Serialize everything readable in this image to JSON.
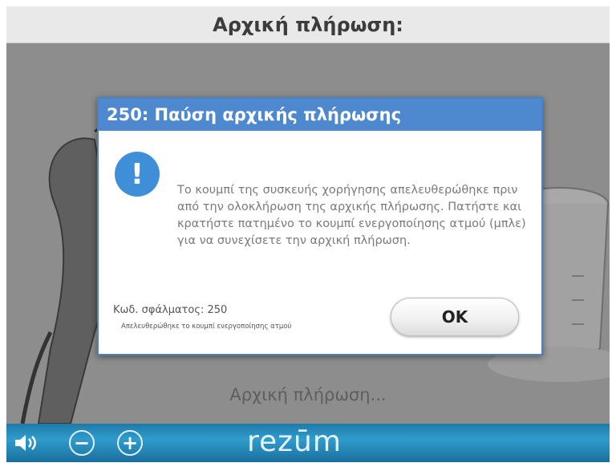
{
  "header": {
    "title": "Αρχική πλήρωση:"
  },
  "background": {
    "status_text": "Αρχική πλήρωση..."
  },
  "footer": {
    "brand": "rezūm",
    "speaker_icon": "speaker-icon",
    "minus_label": "−",
    "plus_label": "+"
  },
  "dialog": {
    "title": "250: Παύση αρχικής πλήρωσης",
    "icon_glyph": "!",
    "message": "Το κουμπί της συσκευής χορήγησης απελευθερώθηκε πριν από την ολοκλήρωση της αρχικής πλήρωσης. Πατήστε και κρατήστε πατημένο το κουμπί ενεργοποίησης ατμού (μπλε) για να συνεχίσετε την αρχική πλήρωση.",
    "error_code": "Κωδ. σφάλματος: 250",
    "error_detail": "Απελευθερώθηκε το κουμπί ενεργοποίησης ατμού",
    "ok_label": "OK"
  },
  "colors": {
    "header_bg": "#e9e9e9",
    "dialog_titlebar": "#4e88cf",
    "alert_icon": "#3f8fd8",
    "footer_water": "#2f9ccd"
  }
}
